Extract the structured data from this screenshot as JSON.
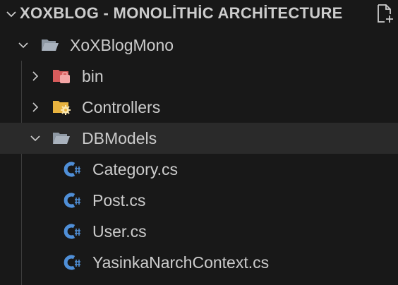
{
  "header": {
    "title": "XOXBLOG - MONOLİTHİC ARCHİTECTURE",
    "new_file_icon": "new-file-icon",
    "expand_icon": "chevron-down-icon"
  },
  "tree": {
    "root": {
      "label": "XoXBlogMono",
      "icon": "folder-open-icon",
      "expanded": true
    },
    "items": [
      {
        "label": "bin",
        "icon": "folder-bin-icon",
        "expanded": false
      },
      {
        "label": "Controllers",
        "icon": "folder-controllers-icon",
        "expanded": false
      },
      {
        "label": "DBModels",
        "icon": "folder-open-icon",
        "expanded": true,
        "selected": true
      }
    ],
    "files": [
      {
        "label": "Category.cs",
        "icon": "csharp-file-icon"
      },
      {
        "label": "Post.cs",
        "icon": "csharp-file-icon"
      },
      {
        "label": "User.cs",
        "icon": "csharp-file-icon"
      },
      {
        "label": "YasinkaNarchContext.cs",
        "icon": "csharp-file-icon"
      }
    ]
  },
  "colors": {
    "background": "#181818",
    "selected_row": "#2a2a2a",
    "text": "#cccccc",
    "csharp_blue": "#4f8fd8",
    "folder_grey": "#a9b2bd",
    "folder_red": "#e26d6d",
    "folder_yellow": "#e8b33f"
  }
}
